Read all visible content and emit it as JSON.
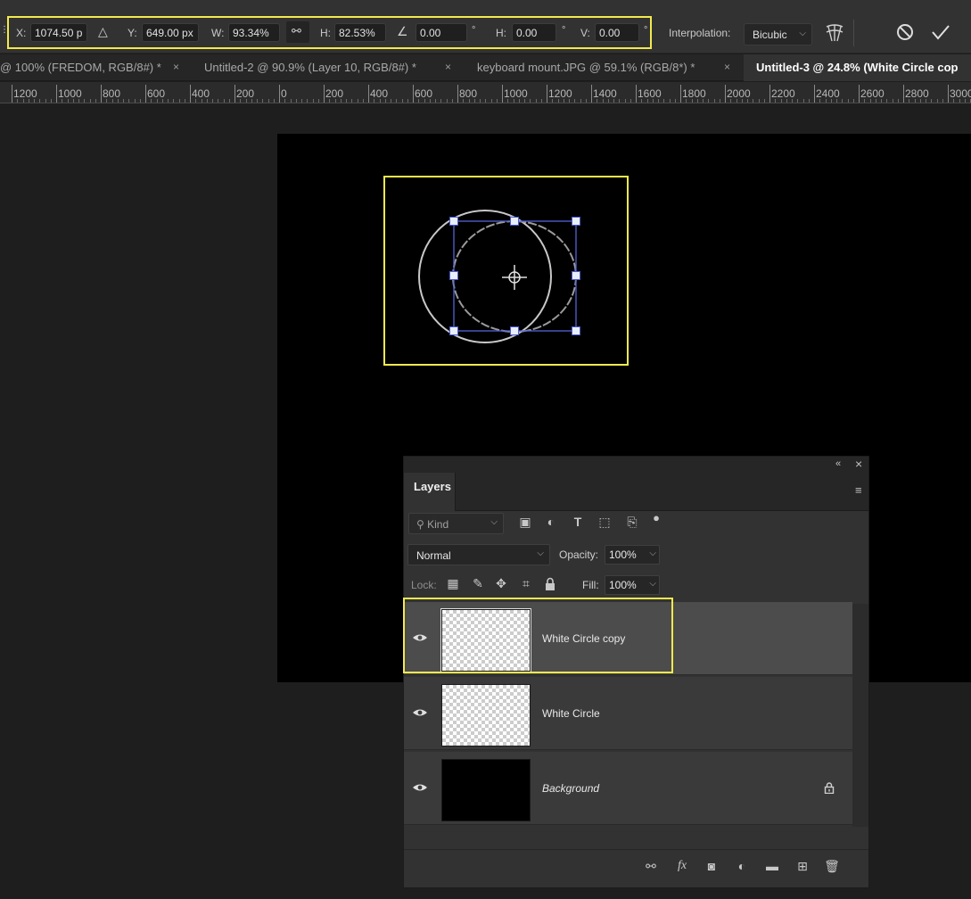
{
  "options_bar": {
    "x_label": "X:",
    "x_value": "1074.50 p",
    "y_label": "Y:",
    "y_value": "649.00 px",
    "w_label": "W:",
    "w_value": "93.34%",
    "h_label": "H:",
    "h_value": "82.53%",
    "angle_value": "0.00",
    "skew_h_label": "H:",
    "skew_h_value": "0.00",
    "skew_v_label": "V:",
    "skew_v_value": "0.00",
    "degree_symbol": "°",
    "interpolation_label": "Interpolation:",
    "interpolation_value": "Bicubic"
  },
  "tabs": [
    {
      "label": "@ 100% (FREDOM, RGB/8#) *",
      "active": false
    },
    {
      "label": "Untitled-2 @ 90.9% (Layer 10, RGB/8#) *",
      "active": false
    },
    {
      "label": "keyboard mount.JPG @ 59.1% (RGB/8*) *",
      "active": false
    },
    {
      "label": "Untitled-3 @ 24.8% (White Circle cop",
      "active": true
    }
  ],
  "tab_close_glyph": "×",
  "ruler": {
    "labels": [
      "1200",
      "1000",
      "800",
      "600",
      "400",
      "200",
      "0",
      "200",
      "400",
      "600",
      "800",
      "1000",
      "1200",
      "1400",
      "1600",
      "1800",
      "2000",
      "2200",
      "2400",
      "2600",
      "2800",
      "3000"
    ]
  },
  "layers_panel": {
    "title": "Layers",
    "kind_placeholder": "Kind",
    "blend_mode": "Normal",
    "opacity_label": "Opacity:",
    "opacity_value": "100%",
    "lock_label": "Lock:",
    "fill_label": "Fill:",
    "fill_value": "100%",
    "layers": [
      {
        "name": "White Circle copy",
        "selected": true,
        "thumb": "checker",
        "locked": false
      },
      {
        "name": "White Circle",
        "selected": false,
        "thumb": "checker",
        "locked": false
      },
      {
        "name": "Background",
        "selected": false,
        "thumb": "black",
        "locked": true
      }
    ]
  },
  "colors": {
    "highlight": "#f2e94e",
    "transform_box": "#5563d6",
    "circle_stroke": "#c8c8c8"
  }
}
